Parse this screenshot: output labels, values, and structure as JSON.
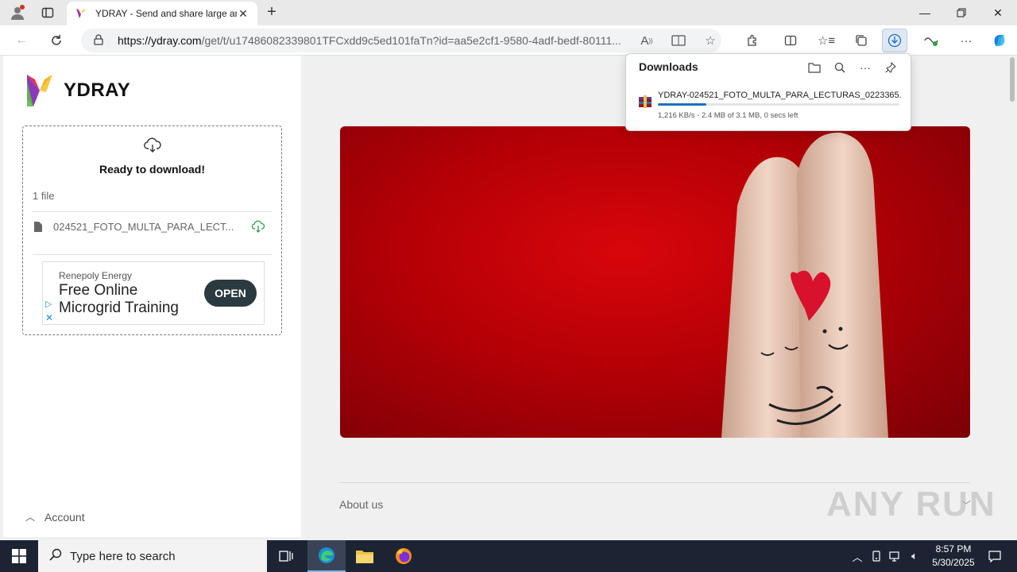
{
  "browser": {
    "tab_title": "YDRAY - Send and share large an",
    "url_domain": "https://ydray.com",
    "url_path": "/get/t/u17486082339801TFCxdd9c5ed101faTn?id=aa5e2cf1-9580-4adf-bedf-80111..."
  },
  "downloads": {
    "title": "Downloads",
    "item": {
      "filename": "YDRAY-024521_FOTO_MULTA_PARA_LECTURAS_0223365...",
      "progress": 0.2,
      "status": "1,216 KB/s - 2.4 MB of 3.1 MB, 0 secs left"
    }
  },
  "site": {
    "logo_text": "YDRAY",
    "ready_text": "Ready to download!",
    "file_count": "1 file",
    "file_name": "024521_FOTO_MULTA_PARA_LECT...",
    "ad": {
      "brand": "Renepoly Energy",
      "headline": "Free Online Microgrid Training",
      "button": "OPEN"
    },
    "account_label": "Account",
    "footer_link": "About us"
  },
  "watermark": "ANY RUN",
  "taskbar": {
    "search_placeholder": "Type here to search",
    "time": "8:57 PM",
    "date": "5/30/2025"
  },
  "colors": {
    "accent": "#1f6fc0",
    "hero_red": "#c2000a",
    "ad_button": "#2b3a40"
  }
}
